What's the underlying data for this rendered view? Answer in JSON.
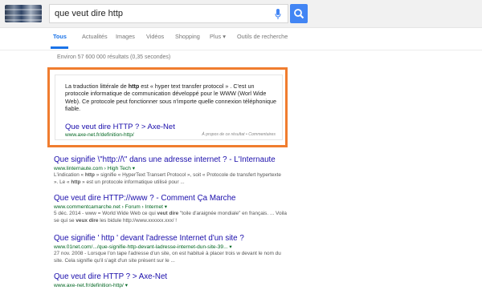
{
  "search": {
    "query": "que veut dire http"
  },
  "tabs": [
    {
      "label": "Tous"
    },
    {
      "label": "Actualités"
    },
    {
      "label": "Images"
    },
    {
      "label": "Vidéos"
    },
    {
      "label": "Shopping"
    },
    {
      "label": "Plus ▾"
    },
    {
      "label": "Outils de recherche"
    }
  ],
  "stats": "Environ 57 600 000 résultats (0,35 secondes)",
  "featured": {
    "text_1": "La traduction littérale de ",
    "text_bold": "http",
    "text_2": " est « hyper text transfer protocol » . C'est un protocole informatique de communication développé pour le WWW (Worl Wide Web). Ce protocole peut fonctionner sous n'importe quelle connexion téléphonique fiable.",
    "link": "Que veut dire HTTP ? > Axe-Net",
    "url": "www.axe-net.fr/definition-http/",
    "footer": "À propos de ce résultat • Commentaires"
  },
  "results": [
    {
      "title": "Que signifie \\\"http://\\\" dans une adresse internet ? - L'Internaute",
      "url": "www.linternaute.com › High Tech ▾",
      "desc_1": "L'indication « ",
      "desc_b1": "http",
      "desc_2": " » signifie « HyperText Transert Protocol », soit « Protocole de transfert hypertexte ». Le « ",
      "desc_b2": "http",
      "desc_3": " » est un protocole informatique utilisé pour ..."
    },
    {
      "title": "Que veut dire HTTP://www ? - Comment Ça Marche",
      "url": "www.commentcamarche.net › Forum › Internet ▾",
      "desc_1": "5 déc. 2014 - www = World Wide Web ce qui ",
      "desc_b1": "veut dire",
      "desc_2": " \"toile d'araignée mondiale\" en français. ... Voila se qui se ",
      "desc_b2": "veux dire",
      "desc_3": " les bidule http://www.xxxxxx.xxx/ !"
    },
    {
      "title": "Que signifie ' http ' devant l'adresse Internet d'un site ?",
      "url": "www.01net.com/.../que-signifie-http-devant-ladresse-internet-dun-site-39... ▾",
      "desc_1": "27 nov. 2008 - Lorsque l'on tape l'adresse d'un site, on est habitué à placer trois w devant le nom du site. Cela signifie qu'il s'agit d'un site présent sur le ...",
      "desc_b1": "",
      "desc_2": "",
      "desc_b2": "",
      "desc_3": ""
    },
    {
      "title": "Que veut dire HTTP ? > Axe-Net",
      "url": "www.axe-net.fr/definition-http/ ▾"
    }
  ]
}
